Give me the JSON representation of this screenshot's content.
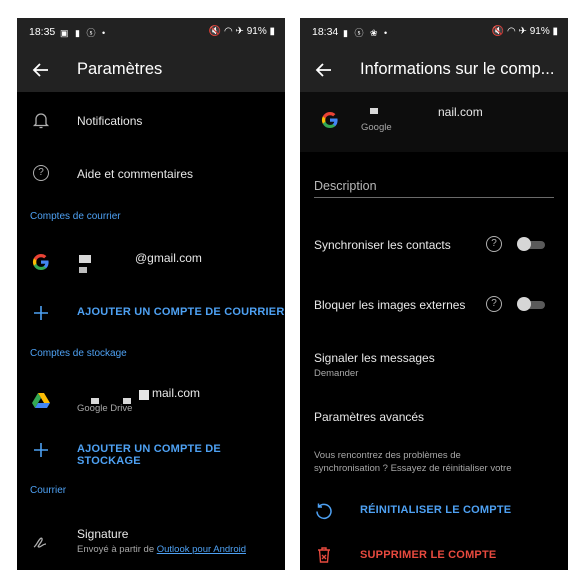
{
  "left": {
    "status": {
      "time": "18:35",
      "battery": "91%"
    },
    "title": "Paramètres",
    "items": {
      "notifications": "Notifications",
      "help": "Aide et commentaires"
    },
    "mail_section": "Comptes de courrier",
    "mail_account": {
      "email_suffix": "@gmail.com"
    },
    "add_mail": "AJOUTER UN COMPTE DE COURRIER",
    "storage_section": "Comptes de stockage",
    "storage_account": {
      "email_suffix": "mail.com",
      "provider": "Google Drive"
    },
    "add_storage": "AJOUTER UN COMPTE DE STOCKAGE",
    "mail_section2": "Courrier",
    "signature": {
      "title": "Signature",
      "sent_from": "Envoyé à partir de",
      "link": "Outlook pour Android"
    }
  },
  "right": {
    "status": {
      "time": "18:34",
      "battery": "91%"
    },
    "title": "Informations sur le comp...",
    "account": {
      "email_suffix": "nail.com",
      "provider": "Google"
    },
    "description_placeholder": "Description",
    "sync_contacts": "Synchroniser les contacts",
    "block_images": "Bloquer les images externes",
    "report": {
      "title": "Signaler les messages",
      "value": "Demander"
    },
    "advanced": "Paramètres avancés",
    "sync_help": {
      "line1": "Vous rencontrez des problèmes de",
      "line2": "synchronisation ? Essayez de réinitialiser votre"
    },
    "reset": "RÉINITIALISER LE COMPTE",
    "delete": "SUPPRIMER LE COMPTE"
  },
  "colors": {
    "accent": "#4ea1f3",
    "danger": "#e84a3f",
    "appbar": "#222222",
    "background": "#000000"
  }
}
